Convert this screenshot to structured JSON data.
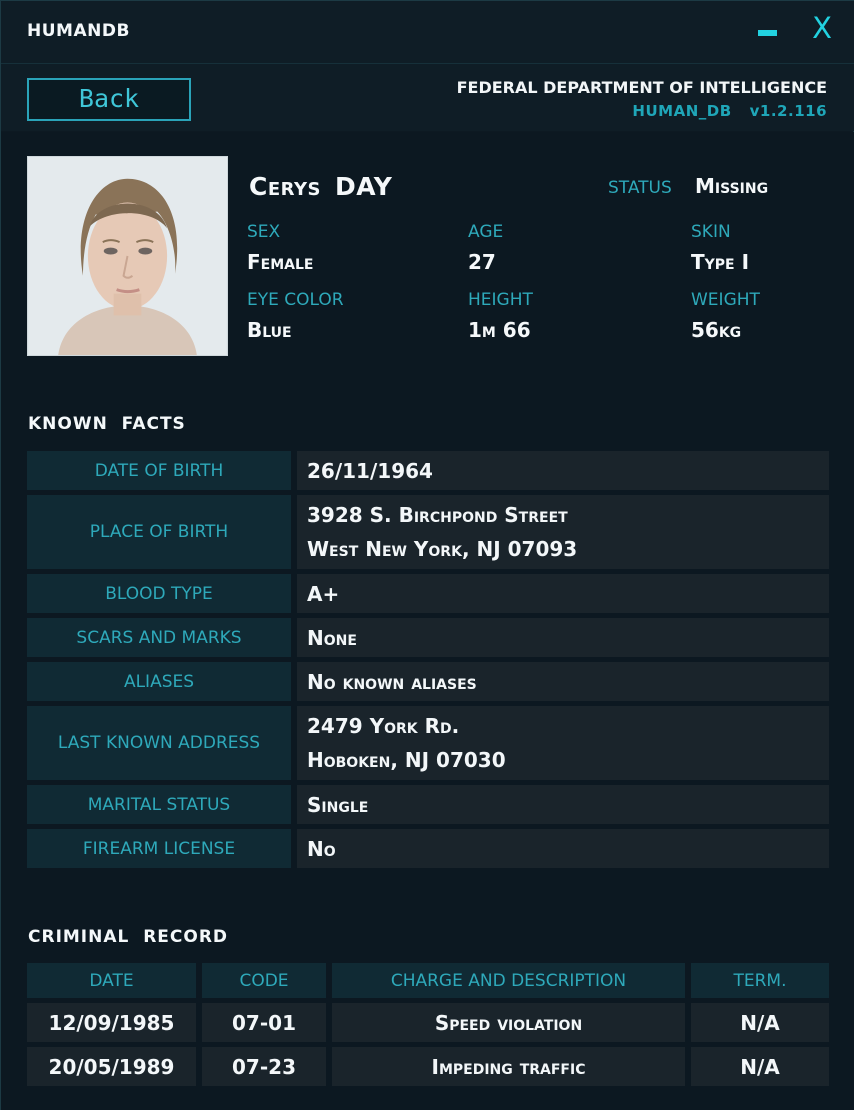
{
  "window": {
    "title": "HUMANDB",
    "minimize_icon": "minimize-icon",
    "close_label": "X"
  },
  "header": {
    "back_label": "Back",
    "department": "FEDERAL DEPARTMENT OF INTELLIGENCE",
    "db_name": "HUMAN_DB",
    "version": "v1.2.116"
  },
  "profile": {
    "first_name": "Cerys",
    "last_name": "DAY",
    "status_label": "STATUS",
    "status_value": "Missing",
    "attributes": [
      {
        "label": "SEX",
        "value": "Female"
      },
      {
        "label": "AGE",
        "value": "27"
      },
      {
        "label": "SKIN",
        "value": "Type I"
      },
      {
        "label": "EYE COLOR",
        "value": "Blue"
      },
      {
        "label": "HEIGHT",
        "value": "1m 66"
      },
      {
        "label": "WEIGHT",
        "value": "56kg"
      }
    ]
  },
  "known_facts": {
    "title": "KNOWN  FACTS",
    "rows": [
      {
        "label": "DATE OF BIRTH",
        "lines": [
          "26/11/1964"
        ]
      },
      {
        "label": "PLACE OF BIRTH",
        "lines": [
          "3928 S. Birchpond Street",
          "West New York, NJ 07093"
        ]
      },
      {
        "label": "BLOOD TYPE",
        "lines": [
          "A+"
        ]
      },
      {
        "label": "SCARS AND MARKS",
        "lines": [
          "None"
        ]
      },
      {
        "label": "ALIASES",
        "lines": [
          "No known aliases"
        ]
      },
      {
        "label": "LAST KNOWN ADDRESS",
        "lines": [
          "2479 York Rd.",
          "Hoboken, NJ 07030"
        ]
      },
      {
        "label": "MARITAL STATUS",
        "lines": [
          "Single"
        ]
      },
      {
        "label": "FIREARM LICENSE",
        "lines": [
          "No"
        ]
      }
    ]
  },
  "criminal_record": {
    "title": "CRIMINAL  RECORD",
    "columns": [
      "DATE",
      "CODE",
      "CHARGE AND DESCRIPTION",
      "TERM."
    ],
    "rows": [
      [
        "12/09/1985",
        "07-01",
        "Speed violation",
        "N/A"
      ],
      [
        "20/05/1989",
        "07-23",
        "Impeding traffic",
        "N/A"
      ]
    ]
  },
  "colors": {
    "accent": "#22d2e0",
    "label": "#2ea9ba",
    "background": "#0d1922"
  }
}
